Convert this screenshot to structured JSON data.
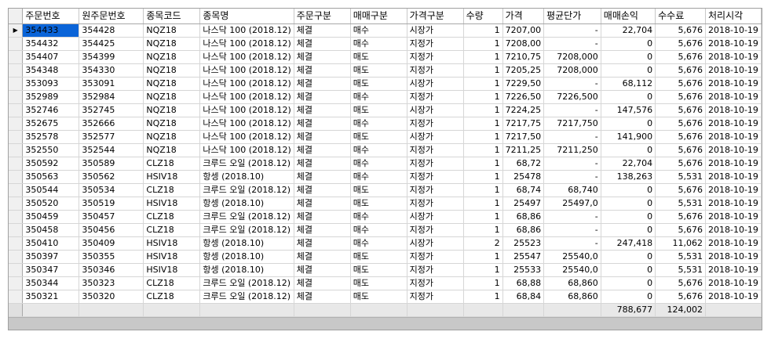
{
  "columns": [
    "주문번호",
    "원주문번호",
    "종목코드",
    "종목명",
    "주문구분",
    "매매구분",
    "가격구분",
    "수량",
    "가격",
    "평균단가",
    "매매손익",
    "수수료",
    "처리시각"
  ],
  "selected_row": 0,
  "row_indicator": "▶",
  "rows": [
    {
      "order_no": "354433",
      "orig_order_no": "354428",
      "code": "NQZ18",
      "name": "나스닥 100 (2018.12)",
      "order_type": "체결",
      "side": "매수",
      "price_type": "시장가",
      "qty": "1",
      "price": "7207,00",
      "avg_price": "-",
      "pnl": "22,704",
      "fee": "5,676",
      "time": "2018-10-19"
    },
    {
      "order_no": "354432",
      "orig_order_no": "354425",
      "code": "NQZ18",
      "name": "나스닥 100 (2018.12)",
      "order_type": "체결",
      "side": "매수",
      "price_type": "지정가",
      "qty": "1",
      "price": "7208,00",
      "avg_price": "-",
      "pnl": "0",
      "fee": "5,676",
      "time": "2018-10-19"
    },
    {
      "order_no": "354407",
      "orig_order_no": "354399",
      "code": "NQZ18",
      "name": "나스닥 100 (2018.12)",
      "order_type": "체결",
      "side": "매도",
      "price_type": "지정가",
      "qty": "1",
      "price": "7210,75",
      "avg_price": "7208,000",
      "pnl": "0",
      "fee": "5,676",
      "time": "2018-10-19"
    },
    {
      "order_no": "354348",
      "orig_order_no": "354330",
      "code": "NQZ18",
      "name": "나스닥 100 (2018.12)",
      "order_type": "체결",
      "side": "매도",
      "price_type": "지정가",
      "qty": "1",
      "price": "7205,25",
      "avg_price": "7208,000",
      "pnl": "0",
      "fee": "5,676",
      "time": "2018-10-19"
    },
    {
      "order_no": "353093",
      "orig_order_no": "353091",
      "code": "NQZ18",
      "name": "나스닥 100 (2018.12)",
      "order_type": "체결",
      "side": "매도",
      "price_type": "시장가",
      "qty": "1",
      "price": "7229,50",
      "avg_price": "-",
      "pnl": "68,112",
      "fee": "5,676",
      "time": "2018-10-19"
    },
    {
      "order_no": "352989",
      "orig_order_no": "352984",
      "code": "NQZ18",
      "name": "나스닥 100 (2018.12)",
      "order_type": "체결",
      "side": "매수",
      "price_type": "지정가",
      "qty": "1",
      "price": "7226,50",
      "avg_price": "7226,500",
      "pnl": "0",
      "fee": "5,676",
      "time": "2018-10-19"
    },
    {
      "order_no": "352746",
      "orig_order_no": "352745",
      "code": "NQZ18",
      "name": "나스닥 100 (2018.12)",
      "order_type": "체결",
      "side": "매도",
      "price_type": "시장가",
      "qty": "1",
      "price": "7224,25",
      "avg_price": "-",
      "pnl": "147,576",
      "fee": "5,676",
      "time": "2018-10-19"
    },
    {
      "order_no": "352675",
      "orig_order_no": "352666",
      "code": "NQZ18",
      "name": "나스닥 100 (2018.12)",
      "order_type": "체결",
      "side": "매수",
      "price_type": "지정가",
      "qty": "1",
      "price": "7217,75",
      "avg_price": "7217,750",
      "pnl": "0",
      "fee": "5,676",
      "time": "2018-10-19"
    },
    {
      "order_no": "352578",
      "orig_order_no": "352577",
      "code": "NQZ18",
      "name": "나스닥 100 (2018.12)",
      "order_type": "체결",
      "side": "매도",
      "price_type": "시장가",
      "qty": "1",
      "price": "7217,50",
      "avg_price": "-",
      "pnl": "141,900",
      "fee": "5,676",
      "time": "2018-10-19"
    },
    {
      "order_no": "352550",
      "orig_order_no": "352544",
      "code": "NQZ18",
      "name": "나스닥 100 (2018.12)",
      "order_type": "체결",
      "side": "매수",
      "price_type": "지정가",
      "qty": "1",
      "price": "7211,25",
      "avg_price": "7211,250",
      "pnl": "0",
      "fee": "5,676",
      "time": "2018-10-19"
    },
    {
      "order_no": "350592",
      "orig_order_no": "350589",
      "code": "CLZ18",
      "name": "크루드 오일 (2018.12)",
      "order_type": "체결",
      "side": "매수",
      "price_type": "지정가",
      "qty": "1",
      "price": "68,72",
      "avg_price": "-",
      "pnl": "22,704",
      "fee": "5,676",
      "time": "2018-10-19"
    },
    {
      "order_no": "350563",
      "orig_order_no": "350562",
      "code": "HSIV18",
      "name": "항셍 (2018.10)",
      "order_type": "체결",
      "side": "매수",
      "price_type": "지정가",
      "qty": "1",
      "price": "25478",
      "avg_price": "-",
      "pnl": "138,263",
      "fee": "5,531",
      "time": "2018-10-19"
    },
    {
      "order_no": "350544",
      "orig_order_no": "350534",
      "code": "CLZ18",
      "name": "크루드 오일 (2018.12)",
      "order_type": "체결",
      "side": "매도",
      "price_type": "지정가",
      "qty": "1",
      "price": "68,74",
      "avg_price": "68,740",
      "pnl": "0",
      "fee": "5,676",
      "time": "2018-10-19"
    },
    {
      "order_no": "350520",
      "orig_order_no": "350519",
      "code": "HSIV18",
      "name": "항셍 (2018.10)",
      "order_type": "체결",
      "side": "매도",
      "price_type": "지정가",
      "qty": "1",
      "price": "25497",
      "avg_price": "25497,0",
      "pnl": "0",
      "fee": "5,531",
      "time": "2018-10-19"
    },
    {
      "order_no": "350459",
      "orig_order_no": "350457",
      "code": "CLZ18",
      "name": "크루드 오일 (2018.12)",
      "order_type": "체결",
      "side": "매수",
      "price_type": "시장가",
      "qty": "1",
      "price": "68,86",
      "avg_price": "-",
      "pnl": "0",
      "fee": "5,676",
      "time": "2018-10-19"
    },
    {
      "order_no": "350458",
      "orig_order_no": "350456",
      "code": "CLZ18",
      "name": "크루드 오일 (2018.12)",
      "order_type": "체결",
      "side": "매수",
      "price_type": "지정가",
      "qty": "1",
      "price": "68,86",
      "avg_price": "-",
      "pnl": "0",
      "fee": "5,676",
      "time": "2018-10-19"
    },
    {
      "order_no": "350410",
      "orig_order_no": "350409",
      "code": "HSIV18",
      "name": "항셍 (2018.10)",
      "order_type": "체결",
      "side": "매수",
      "price_type": "시장가",
      "qty": "2",
      "price": "25523",
      "avg_price": "-",
      "pnl": "247,418",
      "fee": "11,062",
      "time": "2018-10-19"
    },
    {
      "order_no": "350397",
      "orig_order_no": "350355",
      "code": "HSIV18",
      "name": "항셍 (2018.10)",
      "order_type": "체결",
      "side": "매도",
      "price_type": "지정가",
      "qty": "1",
      "price": "25547",
      "avg_price": "25540,0",
      "pnl": "0",
      "fee": "5,531",
      "time": "2018-10-19"
    },
    {
      "order_no": "350347",
      "orig_order_no": "350346",
      "code": "HSIV18",
      "name": "항셍 (2018.10)",
      "order_type": "체결",
      "side": "매도",
      "price_type": "지정가",
      "qty": "1",
      "price": "25533",
      "avg_price": "25540,0",
      "pnl": "0",
      "fee": "5,531",
      "time": "2018-10-19"
    },
    {
      "order_no": "350344",
      "orig_order_no": "350323",
      "code": "CLZ18",
      "name": "크루드 오일 (2018.12)",
      "order_type": "체결",
      "side": "매도",
      "price_type": "지정가",
      "qty": "1",
      "price": "68,88",
      "avg_price": "68,860",
      "pnl": "0",
      "fee": "5,676",
      "time": "2018-10-19"
    },
    {
      "order_no": "350321",
      "orig_order_no": "350320",
      "code": "CLZ18",
      "name": "크루드 오일 (2018.12)",
      "order_type": "체결",
      "side": "매도",
      "price_type": "지정가",
      "qty": "1",
      "price": "68,84",
      "avg_price": "68,860",
      "pnl": "0",
      "fee": "5,676",
      "time": "2018-10-19"
    }
  ],
  "totals": {
    "pnl": "788,677",
    "fee": "124,002"
  },
  "colors": {
    "buy": "#e00000",
    "sell": "#0000d8",
    "loss": "#e00000",
    "selection": "#0a64d8"
  }
}
